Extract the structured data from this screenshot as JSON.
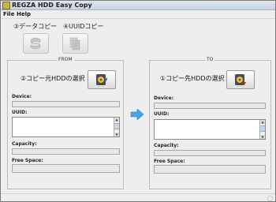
{
  "window": {
    "title": "REGZA HDD Easy Copy"
  },
  "menu": {
    "file": "File",
    "help": "Help"
  },
  "toolbar": {
    "data_copy_label": "③データコピー",
    "uuid_copy_label": "④UUIDコピー"
  },
  "from_panel": {
    "title": "FROM",
    "select_label": "②コピー元HDDの選択",
    "device_label": "Device:",
    "uuid_label": "UUID:",
    "capacity_label": "Capacity:",
    "free_space_label": "Free Space:"
  },
  "to_panel": {
    "title": "TO",
    "select_label": "①コピー先HDDの選択",
    "device_label": "Device:",
    "uuid_label": "UUID:",
    "capacity_label": "Capacity:",
    "free_space_label": "Free Space:"
  },
  "colors": {
    "arrow": "#4aa3e0",
    "hdd_red": "#d02020",
    "hdd_blue": "#2a6fd0"
  }
}
